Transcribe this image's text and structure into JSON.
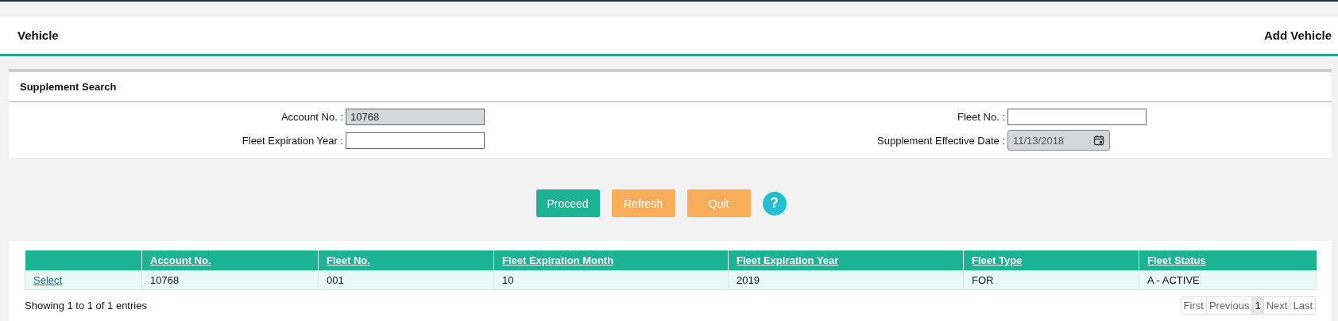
{
  "header": {
    "title": "Vehicle",
    "action": "Add Vehicle"
  },
  "search_panel": {
    "title": "Supplement Search",
    "fields": [
      {
        "label": "Account No. :",
        "value": "10768",
        "disabled": true,
        "kind": "text"
      },
      {
        "label": "Fleet No. :",
        "disabled": false,
        "kind": "text"
      },
      {
        "label": "Fleet Expiration Year :",
        "disabled": false,
        "kind": "text"
      },
      {
        "label": "Supplement Effective Date :",
        "value": "11/13/2018",
        "disabled": true,
        "kind": "date"
      }
    ]
  },
  "buttons": [
    {
      "label": "Proceed",
      "kind": "primary"
    },
    {
      "label": "Refresh",
      "kind": "warning"
    },
    {
      "label": "Quit",
      "kind": "warning"
    },
    {
      "label": "?",
      "kind": "help"
    }
  ],
  "table": {
    "columns": [
      null,
      "Account No.",
      "Fleet No.",
      "Fleet Expiration Month",
      "Fleet Expiration Year",
      "Fleet Type",
      "Fleet Status"
    ],
    "rows": [
      {
        "cells": [
          "Select",
          "10768",
          "001",
          "10",
          "2019",
          "FOR",
          "A - ACTIVE"
        ]
      }
    ]
  },
  "footer": {
    "info": "Showing 1 to 1 of 1 entries",
    "pagination": [
      {
        "label": "First",
        "selected": false
      },
      {
        "label": "Previous",
        "selected": false
      },
      {
        "label": "1",
        "selected": true
      },
      {
        "label": "Next",
        "selected": false
      },
      {
        "label": "Last",
        "selected": false
      }
    ]
  }
}
